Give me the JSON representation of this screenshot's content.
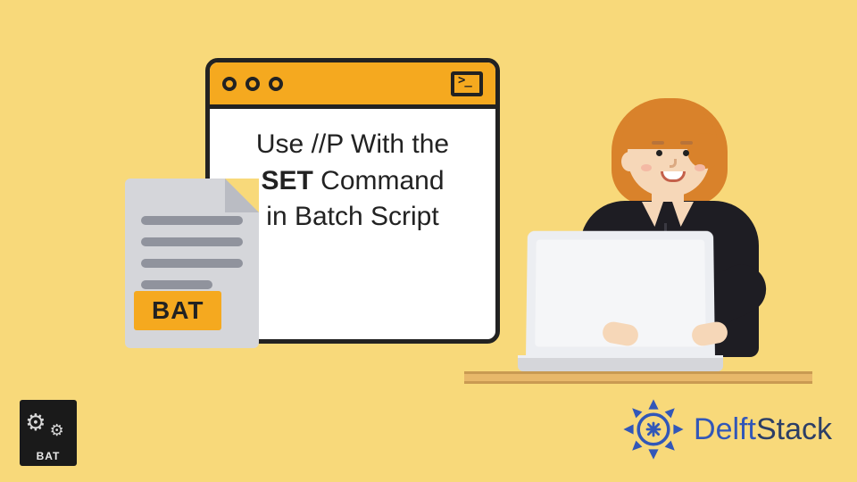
{
  "window": {
    "line1": "Use //P With the",
    "bold": "SET",
    "line2_rest": " Command",
    "line3": "in Batch Script"
  },
  "file": {
    "label": "BAT"
  },
  "corner": {
    "label": "BAT"
  },
  "brand": {
    "name_part1": "Delft",
    "name_part2": "Stack"
  }
}
